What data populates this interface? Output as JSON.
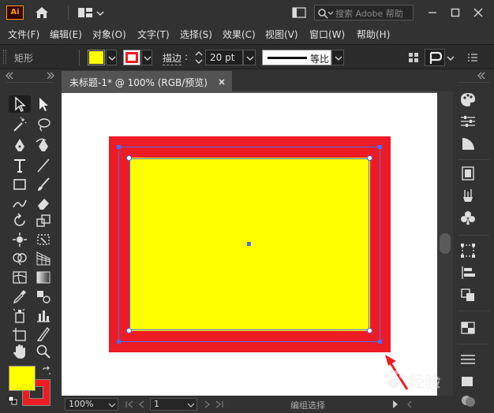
{
  "app": {
    "logo": "Ai"
  },
  "titlebar": {
    "search_placeholder": "搜索 Adobe 帮助"
  },
  "menu": [
    "文件(F)",
    "编辑(E)",
    "对象(O)",
    "文字(T)",
    "选择(S)",
    "效果(C)",
    "视图(V)",
    "窗口(W)",
    "帮助(H)"
  ],
  "control": {
    "selection_label": "矩形",
    "stroke_label": "描边",
    "stroke_weight": "20 pt",
    "profile_label": "等比",
    "fill_color": "#ffff00",
    "stroke_color": "#ed1c24"
  },
  "document": {
    "tab_title": "未标题-1* @ 100% (RGB/预览)"
  },
  "status": {
    "zoom": "100%",
    "page": "1",
    "mode": "编组选择"
  },
  "artwork": {
    "fill_color": "#ffff00",
    "stroke_color": "#ed1c24"
  },
  "watermark": {
    "text": "经验"
  }
}
